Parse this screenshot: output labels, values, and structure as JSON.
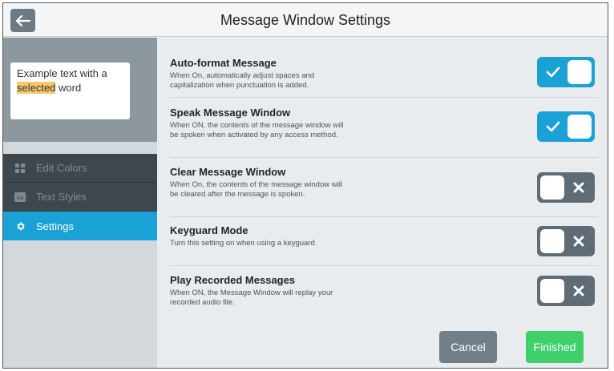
{
  "header": {
    "title": "Message Window Settings",
    "back_icon": "arrow-left-icon"
  },
  "preview": {
    "text_before": "Example text with a ",
    "selected_word": "selected",
    "text_after": " word",
    "highlight_color": "#f5c86b"
  },
  "nav": {
    "items": [
      {
        "label": "Edit Colors",
        "icon": "grid-icon",
        "active": false
      },
      {
        "label": "Text Styles",
        "icon": "text-aa-icon",
        "active": false
      },
      {
        "label": "Settings",
        "icon": "gear-icon",
        "active": true
      }
    ]
  },
  "settings": [
    {
      "title": "Auto-format Message",
      "description": "When On, automatically adjust spaces and capitalization when punctuation is added.",
      "state": "on"
    },
    {
      "title": "Speak Message Window",
      "description": "When ON, the contents of the message window will be spoken when activated by any access method.",
      "state": "on"
    },
    {
      "title": "Clear Message Window",
      "description": "When On, the contents of the message window will be cleared after the message is spoken.",
      "state": "off"
    },
    {
      "title": "Keyguard Mode",
      "description": "Turn this setting on when using a keyguard.",
      "state": "off"
    },
    {
      "title": "Play Recorded Messages",
      "description": "When ON, the Message Window will replay your recorded audio file.",
      "state": "off"
    }
  ],
  "footer": {
    "cancel_label": "Cancel",
    "finished_label": "Finished"
  },
  "colors": {
    "accent": "#1aa1d6",
    "toggle_off": "#5f6c76",
    "finished": "#3fcf6b",
    "cancel": "#737f88"
  }
}
